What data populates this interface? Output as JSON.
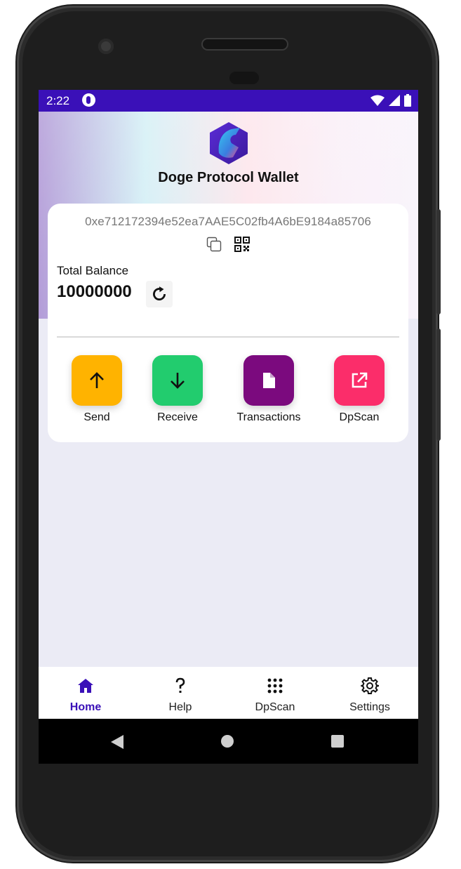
{
  "status_bar": {
    "time": "2:22"
  },
  "header": {
    "title": "Doge Protocol Wallet"
  },
  "account": {
    "address": "0xe712172394e52ea7AAE5C02fb4A6bE9184a85706",
    "balance_label": "Total Balance",
    "balance_value": "10000000"
  },
  "actions": [
    {
      "label": "Send",
      "color": "#ffb300",
      "icon": "arrow-up-icon"
    },
    {
      "label": "Receive",
      "color": "#22cc6e",
      "icon": "arrow-down-icon"
    },
    {
      "label": "Transactions",
      "color": "#7b0a7e",
      "icon": "document-icon"
    },
    {
      "label": "DpScan",
      "color": "#fb2d6a",
      "icon": "open-external-icon"
    }
  ],
  "bottom_nav": [
    {
      "label": "Home",
      "icon": "home-icon",
      "active": true
    },
    {
      "label": "Help",
      "icon": "question-icon",
      "active": false
    },
    {
      "label": "DpScan",
      "icon": "grid-dots-icon",
      "active": false
    },
    {
      "label": "Settings",
      "icon": "gear-icon",
      "active": false
    }
  ],
  "colors": {
    "primary": "#3a10b8",
    "background": "#ebebf5"
  }
}
